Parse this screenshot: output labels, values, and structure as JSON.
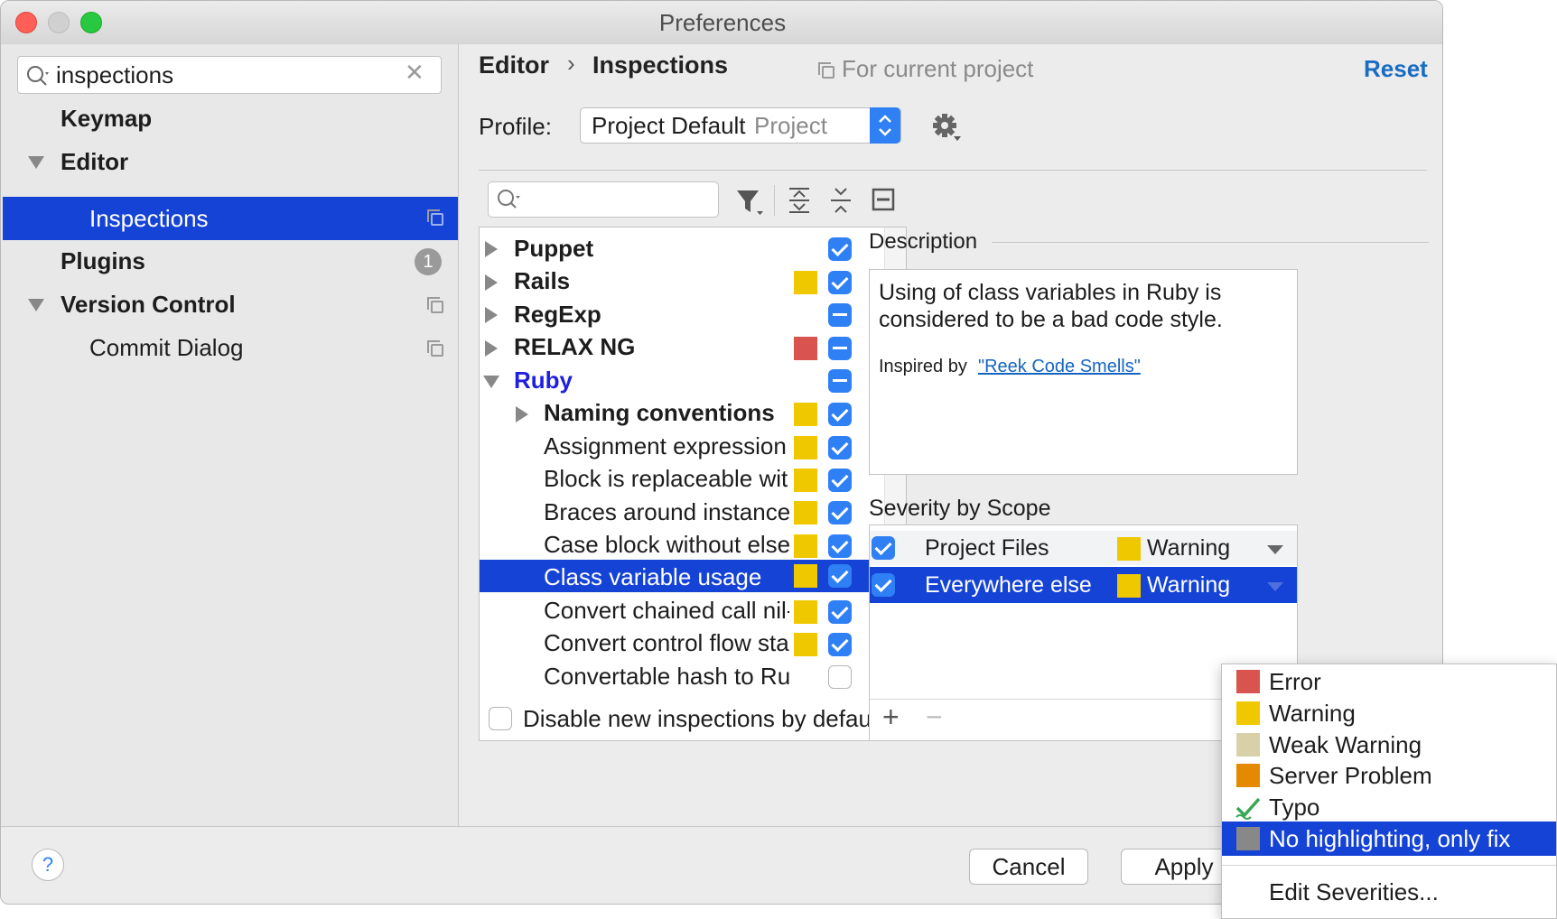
{
  "window": {
    "title": "Preferences"
  },
  "sidebar": {
    "search_value": "inspections",
    "items": [
      {
        "label": "Keymap"
      },
      {
        "label": "Editor"
      },
      {
        "label": "Inspections"
      },
      {
        "label": "Plugins",
        "badge": "1"
      },
      {
        "label": "Version Control"
      },
      {
        "label": "Commit Dialog"
      }
    ]
  },
  "header": {
    "crumb_parent": "Editor",
    "crumb_sep": "›",
    "crumb_current": "Inspections",
    "scope_note": "For current project",
    "reset_label": "Reset"
  },
  "profile": {
    "label": "Profile:",
    "name": "Project Default",
    "type": "Project"
  },
  "inspections": {
    "rows": [
      {
        "label": "Puppet",
        "severity": "",
        "state": "check"
      },
      {
        "label": "Rails",
        "severity": "warning",
        "state": "check"
      },
      {
        "label": "RegExp",
        "severity": "",
        "state": "dash"
      },
      {
        "label": "RELAX NG",
        "severity": "error",
        "state": "dash"
      },
      {
        "label": "Ruby",
        "severity": "",
        "state": "dash"
      },
      {
        "label": "Naming conventions",
        "severity": "warning",
        "state": "check"
      },
      {
        "label": "Assignment expression in conditional",
        "severity": "warning",
        "state": "check"
      },
      {
        "label": "Block is replaceable with",
        "severity": "warning",
        "state": "check"
      },
      {
        "label": "Braces around instance",
        "severity": "warning",
        "state": "check"
      },
      {
        "label": "Case block without else",
        "severity": "warning",
        "state": "check"
      },
      {
        "label": "Class variable usage",
        "severity": "warning",
        "state": "check"
      },
      {
        "label": "Convert chained call nil-",
        "severity": "warning",
        "state": "check"
      },
      {
        "label": "Convert control flow sta",
        "severity": "warning",
        "state": "check"
      },
      {
        "label": "Convertable hash to Rub",
        "severity": "",
        "state": "empty"
      }
    ],
    "disable_new_label": "Disable new inspections by default"
  },
  "description": {
    "heading": "Description",
    "text": "Using of class variables in Ruby is considered to be a bad code style.",
    "inspired_prefix": "Inspired by",
    "inspired_link": "\"Reek Code Smells\""
  },
  "severity_scope": {
    "heading": "Severity by Scope",
    "rows": [
      {
        "scope": "Project Files",
        "severity": "Warning"
      },
      {
        "scope": "Everywhere else",
        "severity": "Warning"
      }
    ],
    "add": "+",
    "remove": "−"
  },
  "severity_menu": {
    "items": [
      {
        "label": "Error",
        "color": "#d9534f"
      },
      {
        "label": "Warning",
        "color": "#f0c800"
      },
      {
        "label": "Weak Warning",
        "color": "#d8d0a8"
      },
      {
        "label": "Server Problem",
        "color": "#e58a00"
      },
      {
        "label": "Typo",
        "color": "#37a855"
      },
      {
        "label": "No highlighting, only fix",
        "color": "#888888"
      }
    ],
    "edit_label": "Edit Severities..."
  },
  "footer": {
    "help": "?",
    "cancel": "Cancel",
    "apply": "Apply"
  },
  "colors": {
    "selection": "#1543d6",
    "link": "#1565c0",
    "accent": "#2f7ff5",
    "ruby": "#1f1fe0"
  }
}
